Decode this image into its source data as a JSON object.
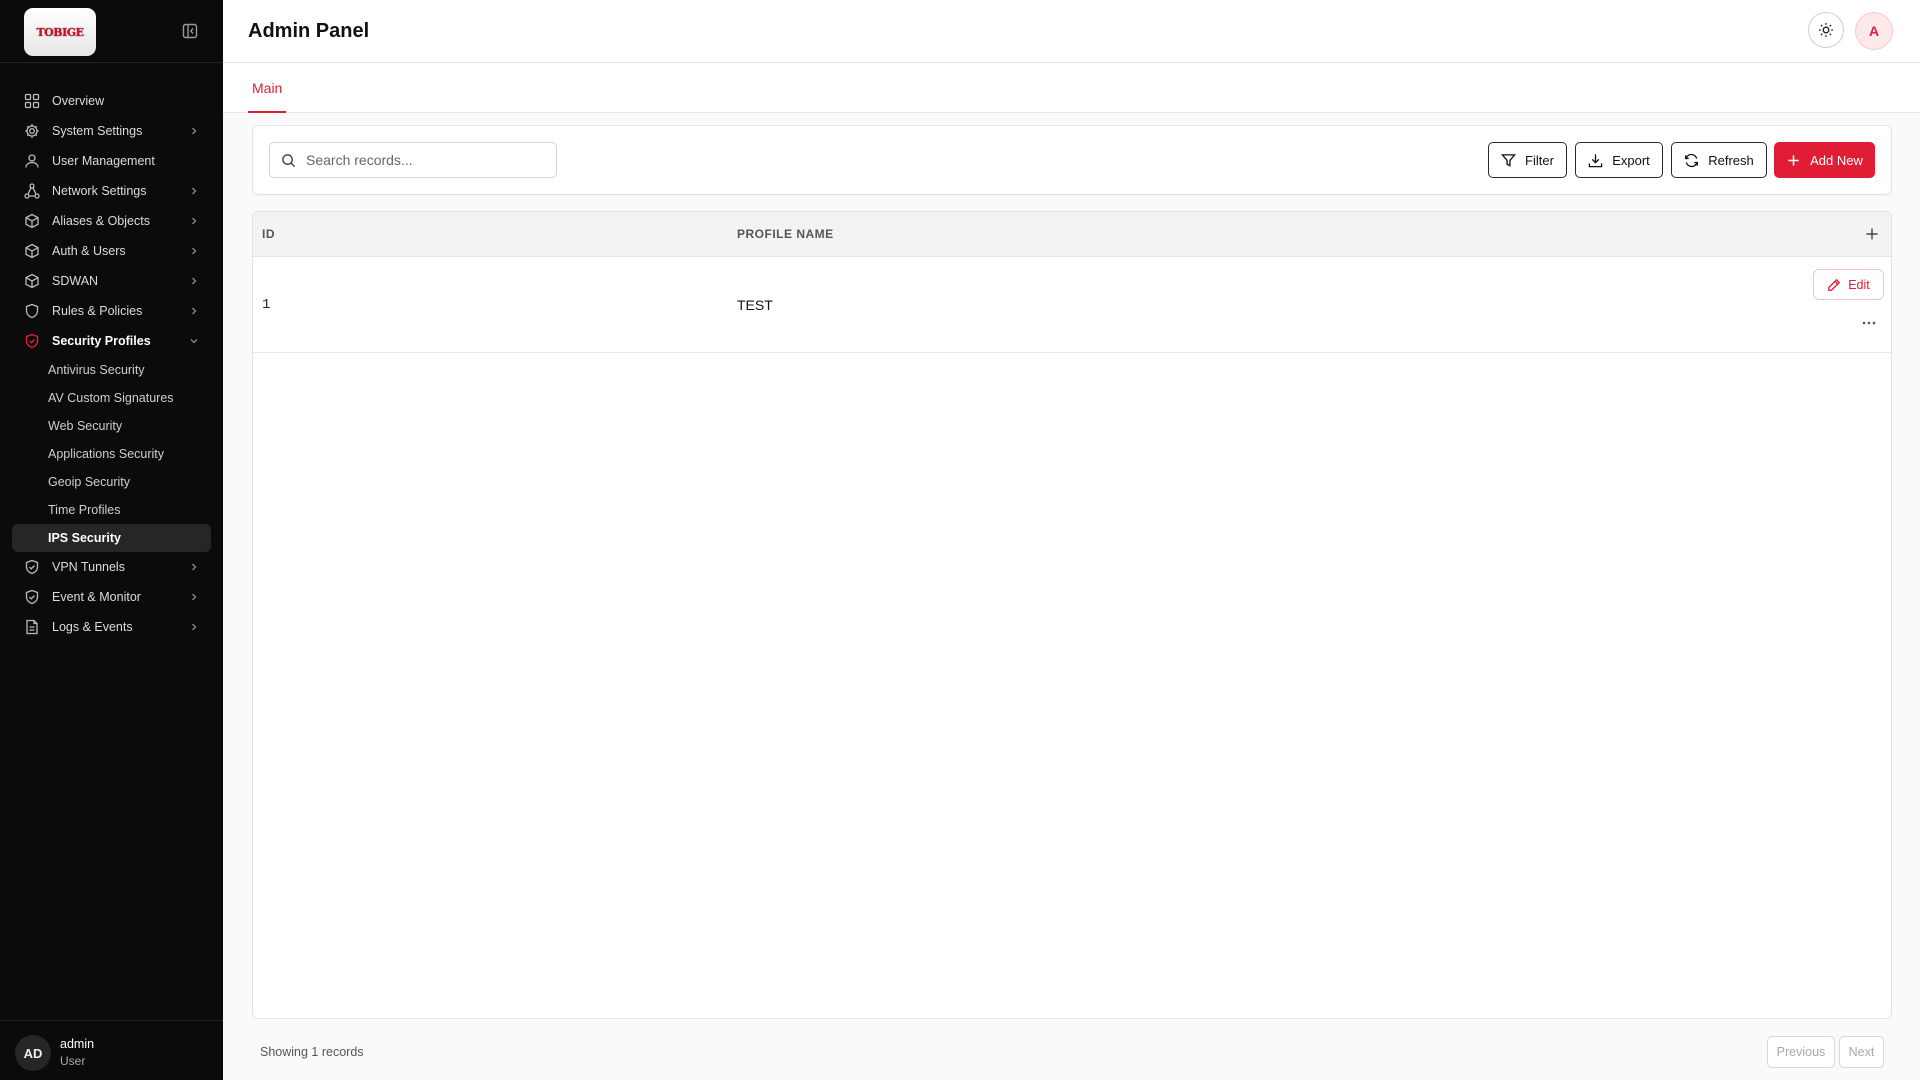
{
  "brand": {
    "logo_text": "TOBIGE",
    "accent": "#e11d36",
    "sidebar_bg": "#0b0b0b"
  },
  "header": {
    "title": "Admin Panel",
    "theme_icon": "sun-icon",
    "user_initial": "A"
  },
  "sidebar": {
    "collapse_icon": "sidebar-collapse-icon",
    "items": [
      {
        "label": "Overview",
        "icon": "grid-icon"
      },
      {
        "label": "System Settings",
        "icon": "gear-icon"
      },
      {
        "label": "User Management",
        "icon": "user-icon"
      },
      {
        "label": "Network Settings",
        "icon": "network-icon"
      },
      {
        "label": "Aliases & Objects",
        "icon": "cube-icon"
      },
      {
        "label": "Auth & Users",
        "icon": "cube-icon"
      },
      {
        "label": "SDWAN",
        "icon": "cube-icon"
      },
      {
        "label": "Rules & Policies",
        "icon": "shield-icon"
      },
      {
        "label": "Security Profiles",
        "icon": "shield-icon"
      },
      {
        "label": "VPN Tunnels",
        "icon": "shield-check-icon"
      },
      {
        "label": "Event & Monitor",
        "icon": "shield-check-icon"
      },
      {
        "label": "Logs & Events",
        "icon": "document-icon"
      }
    ],
    "security_sub": [
      "Antivirus Security",
      "AV Custom Signatures",
      "Web Security",
      "Applications Security",
      "Geoip Security",
      "Time Profiles",
      "IPS Security"
    ],
    "user": {
      "initials": "AD",
      "name": "admin",
      "role": "User"
    }
  },
  "tabs": [
    {
      "label": "Main",
      "active": true
    }
  ],
  "toolbar": {
    "search_placeholder": "Search records...",
    "search_value": "",
    "filter_label": "Filter",
    "export_label": "Export",
    "refresh_label": "Refresh",
    "add_label": "Add New"
  },
  "table": {
    "columns": [
      "ID",
      "PROFILE NAME"
    ],
    "rows": [
      {
        "id": "1",
        "name": "TEST",
        "edit_label": "Edit"
      }
    ]
  },
  "footer": {
    "showing": "Showing 1 records",
    "previous": "Previous",
    "next": "Next"
  }
}
